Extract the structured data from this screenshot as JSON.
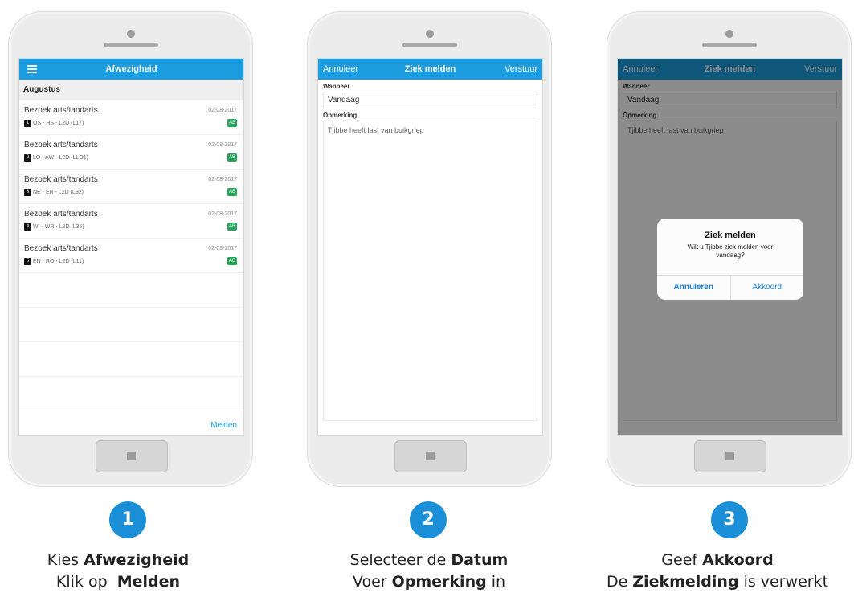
{
  "phone1": {
    "header_title": "Afwezigheid",
    "section": "Augustus",
    "items": [
      {
        "title": "Bezoek arts/tandarts",
        "date": "02-08-2017",
        "num": "1",
        "sub": "OS - HS - L2D (L17)",
        "badge": "AB"
      },
      {
        "title": "Bezoek arts/tandarts",
        "date": "02-08-2017",
        "num": "2",
        "sub": "LO - AW - L2D (LLO1)",
        "badge": "AB"
      },
      {
        "title": "Bezoek arts/tandarts",
        "date": "02-08-2017",
        "num": "3",
        "sub": "NE - ER - L2D (L32)",
        "badge": "AB"
      },
      {
        "title": "Bezoek arts/tandarts",
        "date": "02-08-2017",
        "num": "4",
        "sub": "WI - WR - L2D (L35)",
        "badge": "AB"
      },
      {
        "title": "Bezoek arts/tandarts",
        "date": "02-08-2017",
        "num": "5",
        "sub": "EN - RO - L2D (L11)",
        "badge": "AB"
      }
    ],
    "melden_label": "Melden"
  },
  "phone2": {
    "cancel": "Annuleer",
    "title": "Ziek melden",
    "send": "Verstuur",
    "when_label": "Wanneer",
    "when_value": "Vandaag",
    "remark_label": "Opmerking",
    "remark_value": "Tjibbe heeft last van buikgriep"
  },
  "phone3": {
    "cancel": "Annuleer",
    "title": "Ziek melden",
    "send": "Verstuur",
    "when_label": "Wanneer",
    "when_value": "Vandaag",
    "remark_label": "Opmerking",
    "remark_value": "Tjibbe heeft last van buikgriep",
    "alert_title": "Ziek melden",
    "alert_message": "Wilt u Tjibbe ziek melden voor vandaag?",
    "alert_cancel": "Annuleren",
    "alert_ok": "Akkoord"
  },
  "steps": [
    {
      "number": "1",
      "line1_pre": "Kies ",
      "line1_bold": "Afwezigheid",
      "line1_post": "",
      "line2_pre": "Klik op  ",
      "line2_bold": "Melden",
      "line2_post": ""
    },
    {
      "number": "2",
      "line1_pre": "Selecteer de ",
      "line1_bold": "Datum",
      "line1_post": "",
      "line2_pre": "Voer ",
      "line2_bold": "Opmerking",
      "line2_post": " in"
    },
    {
      "number": "3",
      "line1_pre": "Geef ",
      "line1_bold": "Akkoord",
      "line1_post": "",
      "line2_pre": "De ",
      "line2_bold": "Ziekmelding",
      "line2_post": " is verwerkt"
    }
  ],
  "colors": {
    "accent": "#1b9ddf",
    "badge": "#22a35a",
    "step_circle": "#1a8fd8"
  }
}
